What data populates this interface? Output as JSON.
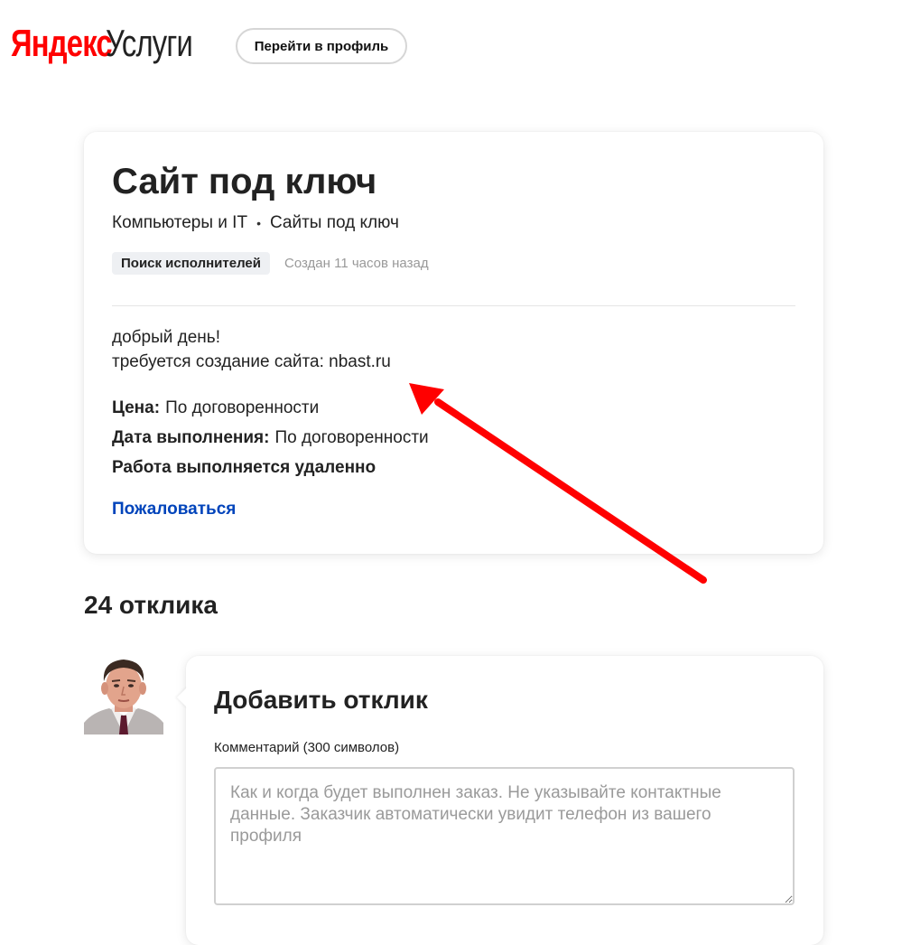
{
  "header": {
    "logo_brand": "Яндекс",
    "logo_product": "Услуги",
    "profile_button": "Перейти в профиль"
  },
  "order": {
    "title": "Сайт под ключ",
    "breadcrumb": [
      "Компьютеры и IT",
      "Сайты под ключ"
    ],
    "breadcrumb_separator": "•",
    "status": "Поиск исполнителей",
    "created": "Создан 11 часов назад",
    "description_lines": [
      "добрый день!",
      "требуется создание сайта: nbast.ru"
    ],
    "price_label": "Цена:",
    "price_value": "По договоренности",
    "date_label": "Дата выполнения:",
    "date_value": "По договоренности",
    "remote_note": "Работа выполняется удаленно",
    "complain_link": "Пожаловаться"
  },
  "responses": {
    "count_heading": "24 отклика"
  },
  "add_response": {
    "title": "Добавить отклик",
    "comment_label": "Комментарий (300 символов)",
    "comment_placeholder": "Как и когда будет выполнен заказ. Не указывайте контактные данные. Заказчик автоматически увидит телефон из вашего профиля",
    "comment_value": ""
  },
  "annotation": {
    "arrow_color": "#ff0000"
  },
  "colors": {
    "brand_red": "#ff0000",
    "link_blue": "#0044bb",
    "badge_bg": "#eef0f3",
    "muted_text": "#999999"
  },
  "icons": {
    "avatar": "user-avatar-photo",
    "annotation": "red-arrow-icon"
  }
}
